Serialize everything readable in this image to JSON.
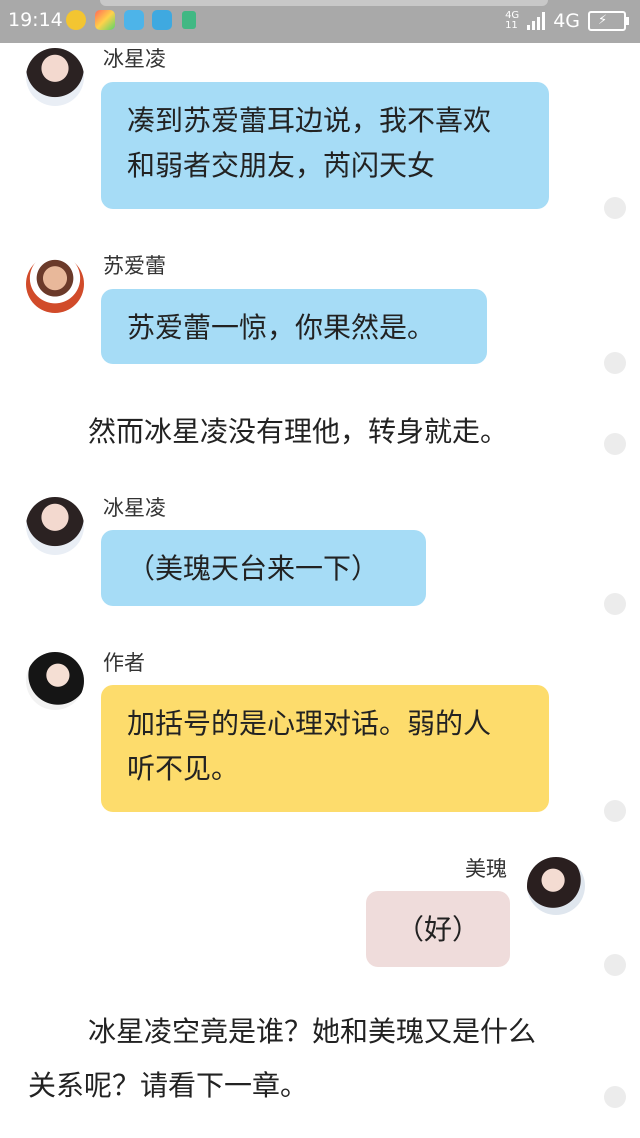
{
  "status_bar": {
    "time": "19:14",
    "signal_small_top": "4G",
    "signal_small_bottom": "11",
    "network": "4G",
    "icons": [
      "app-coin-icon",
      "app-game-icon",
      "chat-icon",
      "scan-icon",
      "lock-icon"
    ]
  },
  "messages": [
    {
      "type": "message",
      "side": "left",
      "sender": "冰星凌",
      "avatar": "girl-1",
      "bubble_color": "#a6dcf6",
      "lines": [
        "凑到苏爱蕾耳边说，我不喜欢",
        "和弱者交朋友，芮闪天女"
      ]
    },
    {
      "type": "message",
      "side": "left",
      "sender": "苏爱蕾",
      "avatar": "boy",
      "bubble_color": "#a6dcf6",
      "lines": [
        "苏爱蕾一惊，你果然是。"
      ]
    },
    {
      "type": "narration",
      "lines": [
        "然而冰星凌没有理他，转身就走。"
      ]
    },
    {
      "type": "message",
      "side": "left",
      "sender": "冰星凌",
      "avatar": "girl-1",
      "bubble_color": "#a6dcf6",
      "lines": [
        "（美瑰天台来一下）"
      ]
    },
    {
      "type": "message",
      "side": "left",
      "sender": "作者",
      "avatar": "girl-2",
      "bubble_color": "#fddc6c",
      "lines": [
        "加括号的是心理对话。弱的人",
        "听不见。"
      ]
    },
    {
      "type": "message",
      "side": "right",
      "sender": "美瑰",
      "avatar": "girl-3",
      "bubble_color": "#efdcdb",
      "lines": [
        "（好）"
      ]
    },
    {
      "type": "narration",
      "lines": [
        "冰星凌空竟是谁？她和美瑰又是什么",
        "关系呢？请看下一章。"
      ]
    }
  ]
}
